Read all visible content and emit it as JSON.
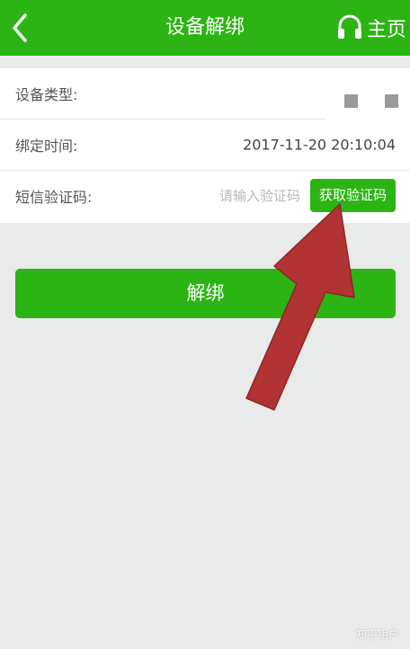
{
  "header": {
    "title": "设备解绑",
    "home_label": "主页",
    "back_icon": "chevron-left-icon",
    "home_icon": "headset-icon",
    "bg_color": "#2cb414"
  },
  "form": {
    "device_type": {
      "label": "设备类型:"
    },
    "bind_time": {
      "label": "绑定时间:",
      "value": "2017-11-20 20:10:04"
    },
    "sms_code": {
      "label": "短信验证码:",
      "placeholder": "请输入验证码",
      "button_label": "获取验证码"
    }
  },
  "unbind_button": {
    "label": "解绑"
  },
  "annotation": {
    "arrow_color": "#b23333"
  },
  "watermark": "知乎用户"
}
